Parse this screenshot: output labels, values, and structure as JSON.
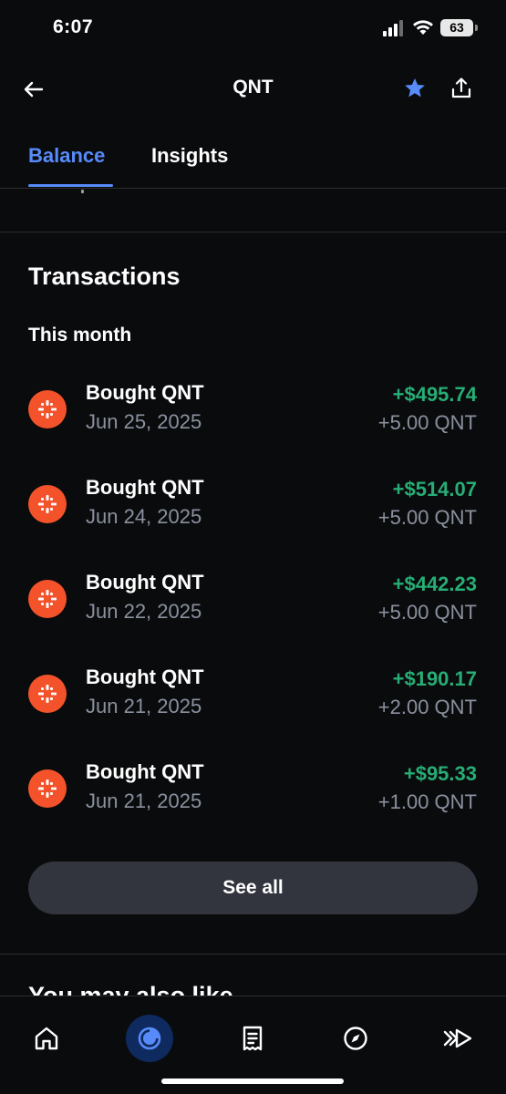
{
  "status_bar": {
    "time": "6:07",
    "battery": "63"
  },
  "header": {
    "title": "QNT"
  },
  "tabs": [
    {
      "label": "Balance",
      "active": true
    },
    {
      "label": "Insights",
      "active": false
    }
  ],
  "transactions": {
    "title": "Transactions",
    "group_label": "This month",
    "items": [
      {
        "title": "Bought QNT",
        "date": "Jun 25, 2025",
        "amount": "+$495.74",
        "quantity": "+5.00 QNT"
      },
      {
        "title": "Bought QNT",
        "date": "Jun 24, 2025",
        "amount": "+$514.07",
        "quantity": "+5.00 QNT"
      },
      {
        "title": "Bought QNT",
        "date": "Jun 22, 2025",
        "amount": "+$442.23",
        "quantity": "+5.00 QNT"
      },
      {
        "title": "Bought QNT",
        "date": "Jun 21, 2025",
        "amount": "+$190.17",
        "quantity": "+2.00 QNT"
      },
      {
        "title": "Bought QNT",
        "date": "Jun 21, 2025",
        "amount": "+$95.33",
        "quantity": "+1.00 QNT"
      }
    ],
    "see_all_label": "See all"
  },
  "next_section": {
    "title": "You may also like"
  },
  "bottom_nav": [
    {
      "icon": "home-icon",
      "active": false
    },
    {
      "icon": "portfolio-icon",
      "active": true
    },
    {
      "icon": "receipt-icon",
      "active": false
    },
    {
      "icon": "compass-icon",
      "active": false
    },
    {
      "icon": "fast-forward-icon",
      "active": false
    }
  ],
  "colors": {
    "background": "#0a0b0d",
    "accent": "#578bfa",
    "positive": "#27ad75",
    "muted": "#8a919e",
    "qnt_brand": "#f3522a"
  }
}
